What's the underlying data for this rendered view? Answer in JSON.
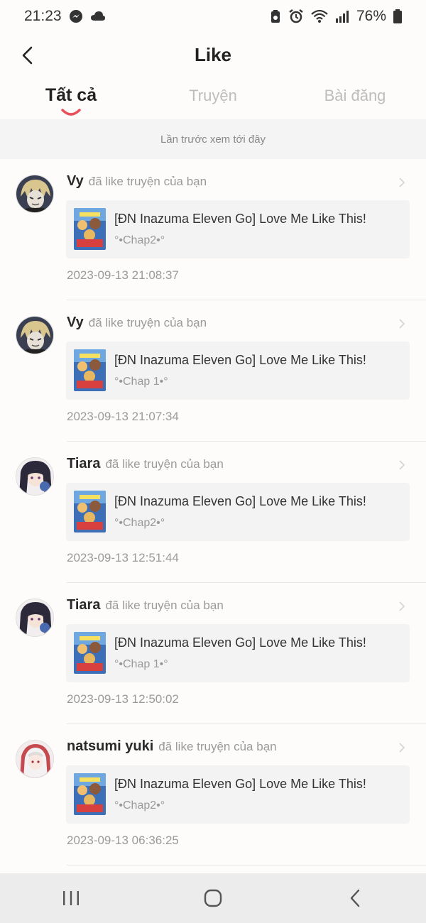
{
  "status_bar": {
    "time": "21:23",
    "battery": "76%",
    "icons": [
      "messenger-icon",
      "cloud-icon",
      "battery-saver-icon",
      "alarm-icon",
      "wifi-icon",
      "signal-icon",
      "battery-icon"
    ]
  },
  "header": {
    "title": "Like",
    "back_icon": "back-arrow-icon"
  },
  "tabs": [
    {
      "label": "Tất cả",
      "active": true
    },
    {
      "label": "Truyện",
      "active": false
    },
    {
      "label": "Bài đăng",
      "active": false
    }
  ],
  "banner": {
    "text": "Lần trước xem tới đây"
  },
  "colors": {
    "accent": "#e8505b",
    "inactive_tab": "#bdbdbd",
    "card_bg": "#f3f3f3"
  },
  "items": [
    {
      "username": "Vy",
      "action": "đã like truyện của bạn",
      "story_title": "[ĐN Inazuma Eleven Go] Love Me Like This!",
      "chapter": "°•Chap2•°",
      "timestamp": "2023-09-13 21:08:37"
    },
    {
      "username": "Vy",
      "action": "đã like truyện của bạn",
      "story_title": "[ĐN Inazuma Eleven Go] Love Me Like This!",
      "chapter": "°•Chap 1•°",
      "timestamp": "2023-09-13 21:07:34"
    },
    {
      "username": "Tiara",
      "action": "đã like truyện của bạn",
      "story_title": "[ĐN Inazuma Eleven Go] Love Me Like This!",
      "chapter": "°•Chap2•°",
      "timestamp": "2023-09-13 12:51:44"
    },
    {
      "username": "Tiara",
      "action": "đã like truyện của bạn",
      "story_title": "[ĐN Inazuma Eleven Go] Love Me Like This!",
      "chapter": "°•Chap 1•°",
      "timestamp": "2023-09-13 12:50:02"
    },
    {
      "username": "natsumi yuki",
      "action": "đã like truyện của bạn",
      "story_title": "[ĐN Inazuma Eleven Go] Love Me Like This!",
      "chapter": "°•Chap2•°",
      "timestamp": "2023-09-13 06:36:25"
    }
  ],
  "navbar": {
    "icons": [
      "recent-apps-icon",
      "home-icon",
      "nav-back-icon"
    ]
  }
}
